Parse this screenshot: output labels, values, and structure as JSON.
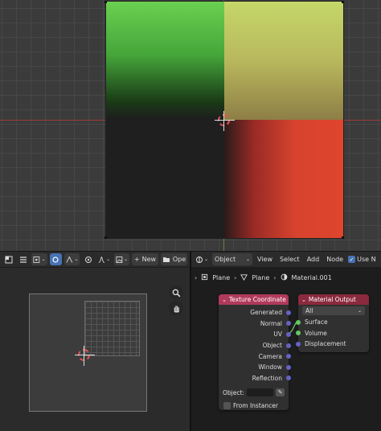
{
  "uv_header": {
    "new_label": "New",
    "open_label": "Ope"
  },
  "node_header": {
    "object_mode": "Object",
    "menus": [
      "View",
      "Select",
      "Add",
      "Node"
    ],
    "use_nodes_label": "Use N"
  },
  "breadcrumb": {
    "object": "Plane",
    "mesh": "Plane",
    "material": "Material.001"
  },
  "texture_coordinate_node": {
    "title": "Texture Coordinate",
    "outputs": [
      "Generated",
      "Normal",
      "UV",
      "Object",
      "Camera",
      "Window",
      "Reflection"
    ],
    "object_label": "Object:",
    "from_instancer_label": "From Instancer"
  },
  "material_output_node": {
    "title": "Material Output",
    "target": "All",
    "inputs": [
      "Surface",
      "Volume",
      "Displacement"
    ]
  },
  "colors": {
    "accent": "#4772b3",
    "texcoord_header": "#b03a5a",
    "output_header": "#8a2a3e",
    "vector_socket": "#6363c7",
    "shader_socket": "#63c763"
  }
}
